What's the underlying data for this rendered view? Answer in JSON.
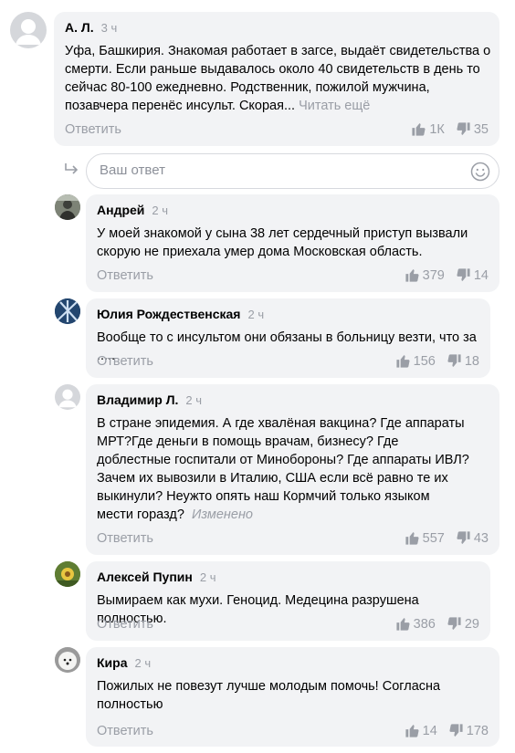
{
  "comments": [
    {
      "author": "А. Л.",
      "time": "3 ч",
      "text": "Уфа, Башкирия. Знакомая работает в загсе, выдаёт свидетельства о смерти. Если раньше выдавалось около 40 свидетельств в день то сейчас 80-100 ежедневно. Родственник, пожилой мужчина, позавчера перенёс инсульт. Скорая...",
      "more_label": "Читать ещё",
      "reply_label": "Ответить",
      "likes": "1К",
      "dislikes": "35"
    },
    {
      "author": "Андрей",
      "time": "2 ч",
      "text": "У моей знакомой у сына 38 лет сердечный приступ вызвали скорую не приехала умер дома Московская область.",
      "reply_label": "Ответить",
      "likes": "379",
      "dislikes": "14"
    },
    {
      "author": "Юлия Рождественская",
      "time": "2 ч",
      "text": "Вообще то с инсультом они обязаны в больницу везти, что за .....",
      "reply_label": "Ответить",
      "likes": "156",
      "dislikes": "18"
    },
    {
      "author": "Владимир Л.",
      "time": "2 ч",
      "text": "В стране эпидемия. А где хвалёная вакцина? Где аппараты МРТ?Где деньги в помощь врачам, бизнесу? Где доблестные госпитали от Минобороны? Где аппараты ИВЛ? Зачем их вывозили в Италию, США если всё равно те их выкинули? Неужто опять наш Кормчий только языком мести горазд?",
      "edited_label": "Изменено",
      "reply_label": "Ответить",
      "likes": "557",
      "dislikes": "43"
    },
    {
      "author": "Алексей Пупин",
      "time": "2 ч",
      "text": "Вымираем как мухи. Геноцид. Медецина разрушена полностью.",
      "reply_label": "Ответить",
      "likes": "386",
      "dislikes": "29"
    },
    {
      "author": "Кира",
      "time": "2 ч",
      "text": "Пожилых не повезут лучше молодым помочь! Согласна полностью",
      "reply_label": "Ответить",
      "likes": "14",
      "dislikes": "178"
    }
  ],
  "reply_box": {
    "placeholder": "Ваш ответ"
  },
  "icons": {
    "like": "thumb-up-icon",
    "dislike": "thumb-down-icon",
    "reply_arrow": "reply-arrow-icon",
    "emoji": "smiley-icon"
  },
  "colors": {
    "bubble": "#f2f3f5",
    "muted": "#9a9ea6",
    "avatar_default": "#d5d7db"
  }
}
